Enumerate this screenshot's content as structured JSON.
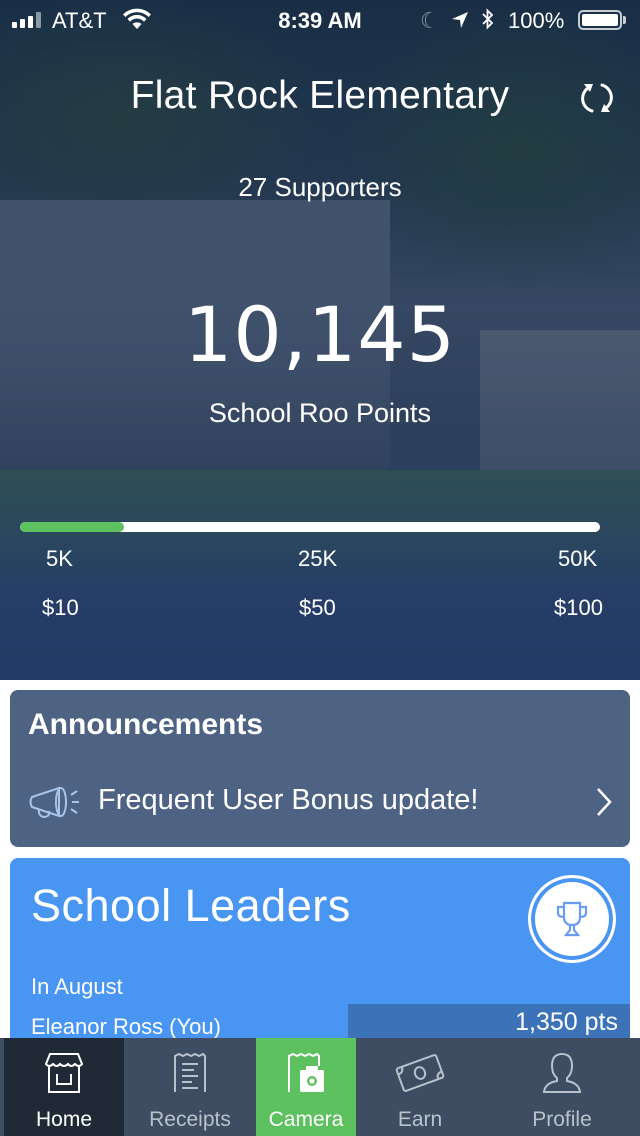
{
  "status_bar": {
    "carrier": "AT&T",
    "time": "8:39 AM",
    "battery_percent": "100%",
    "signal_bars": 4
  },
  "header": {
    "school_name": "Flat Rock Elementary",
    "supporters": "27 Supporters",
    "points_value": "10,145",
    "points_label": "School Roo Points"
  },
  "progress": {
    "current_points": 10145,
    "max_points": 50000,
    "fill_fraction": 0.18,
    "color": "#5cc15e",
    "milestones": [
      {
        "points": "5K",
        "reward": "$10"
      },
      {
        "points": "25K",
        "reward": "$50"
      },
      {
        "points": "50K",
        "reward": "$100"
      }
    ]
  },
  "announcements": {
    "title": "Announcements",
    "items": [
      {
        "text": "Frequent User Bonus update!",
        "icon": "megaphone-icon"
      }
    ]
  },
  "leaders": {
    "title": "School Leaders",
    "period": "In August",
    "entries": [
      {
        "name": "Eleanor Ross (You)",
        "points": "1,350 pts"
      }
    ]
  },
  "tab_bar": {
    "active": "Home",
    "tabs": [
      {
        "label": "Home",
        "icon": "storefront-icon"
      },
      {
        "label": "Receipts",
        "icon": "receipt-icon"
      },
      {
        "label": "Camera",
        "icon": "camera-receipt-icon"
      },
      {
        "label": "Earn",
        "icon": "money-bill-icon"
      },
      {
        "label": "Profile",
        "icon": "person-icon"
      }
    ]
  },
  "colors": {
    "announcements_bg": "#4e6384",
    "leaders_bg": "#4895f2",
    "tab_bar_bg": "#3e4d61",
    "tab_active_bg": "#1f2a36",
    "camera_tab_bg": "#5cc15e"
  }
}
